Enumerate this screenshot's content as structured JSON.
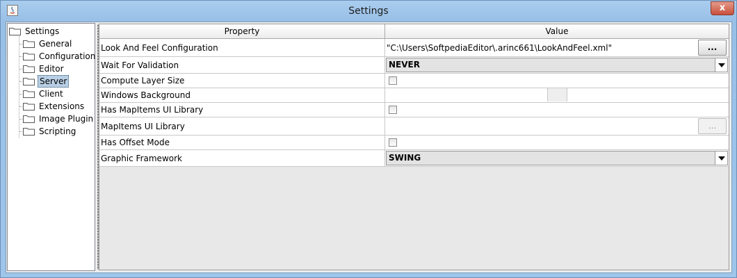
{
  "window": {
    "title": "Settings",
    "close_glyph": "x",
    "app_icon": "java-icon"
  },
  "tree": {
    "root": "Settings",
    "items": [
      {
        "label": "General"
      },
      {
        "label": "Configuration"
      },
      {
        "label": "Editor"
      },
      {
        "label": "Server",
        "selected": true
      },
      {
        "label": "Client"
      },
      {
        "label": "Extensions"
      },
      {
        "label": "Image Plugin"
      },
      {
        "label": "Scripting"
      }
    ]
  },
  "table": {
    "headers": {
      "property": "Property",
      "value": "Value"
    },
    "rows": [
      {
        "property": "Look And Feel Configuration",
        "value": "\"C:\\Users\\SoftpediaEditor\\.arinc661\\LookAndFeel.xml\"",
        "button": "..."
      },
      {
        "property": "Wait For Validation",
        "value": "NEVER"
      },
      {
        "property": "Compute Layer Size",
        "checked": false
      },
      {
        "property": "Windows Background",
        "color": "#eeeeee"
      },
      {
        "property": "Has MapItems UI Library",
        "checked": false
      },
      {
        "property": "MapItems UI Library",
        "value": "",
        "button": "..."
      },
      {
        "property": "Has Offset Mode",
        "checked": false
      },
      {
        "property": "Graphic Framework",
        "value": "SWING"
      }
    ]
  },
  "colors": {
    "titlebar": "#a9cdee",
    "selection": "#b8cfe5",
    "close": "#c8503a"
  }
}
